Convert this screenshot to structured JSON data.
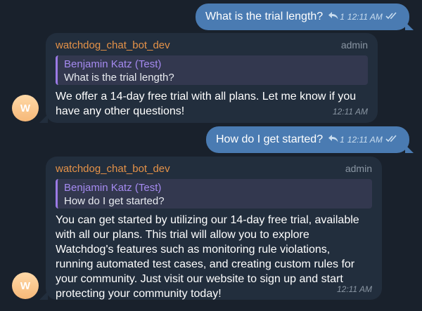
{
  "messages": {
    "out1": {
      "text": "What is the trial length?",
      "reply_count": "1",
      "time": "12:11 AM"
    },
    "bot1": {
      "sender": "watchdog_chat_bot_dev",
      "role": "admin",
      "quote_name": "Benjamin Katz (Test)",
      "quote_text": "What is the trial length?",
      "lines": [
        "We offer a 14-day free trial with all plans. Let me know if you",
        "have any other questions!"
      ],
      "time": "12:11 AM",
      "avatar_letter": "W"
    },
    "out2": {
      "text": "How do I get started?",
      "reply_count": "1",
      "time": "12:11 AM"
    },
    "bot2": {
      "sender": "watchdog_chat_bot_dev",
      "role": "admin",
      "quote_name": "Benjamin Katz (Test)",
      "quote_text": "How do I get started?",
      "lines": [
        "You can get started by utilizing our 14-day free trial, available",
        "with all our plans. This trial will allow you to explore",
        "Watchdog's features such as monitoring rule violations,",
        "running automated test cases, and creating custom rules for",
        "your community. Just visit our website to sign up and start",
        "protecting your community today!"
      ],
      "time": "12:11 AM",
      "avatar_letter": "W"
    }
  },
  "colors": {
    "background": "#19212c",
    "outgoing_bubble": "#4a7bb2",
    "incoming_bubble": "#222e3d",
    "sender_name": "#e59248",
    "quote_accent": "#9b7ae6"
  },
  "icons": {
    "reply": "reply-arrow-icon",
    "read": "double-check-icon"
  }
}
